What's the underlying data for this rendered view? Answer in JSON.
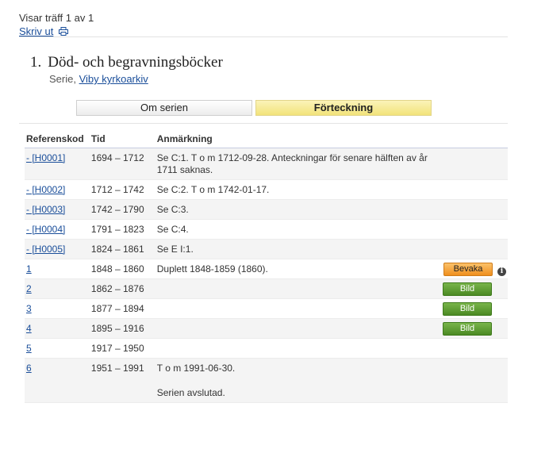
{
  "header": {
    "hits_text": "Visar träff 1 av 1",
    "print_label": "Skriv ut",
    "print_icon": "printer-icon"
  },
  "result": {
    "number": "1.",
    "title": "Död- och begravningsböcker",
    "type_label": "Serie,",
    "archive_link": "Viby kyrkoarkiv"
  },
  "tabs": [
    {
      "label": "Om serien",
      "active": false
    },
    {
      "label": "Förteckning",
      "active": true
    }
  ],
  "table": {
    "columns": [
      "Referenskod",
      "Tid",
      "Anmärkning"
    ],
    "rows": [
      {
        "ref": "- [H0001]",
        "time": "1694 – 1712",
        "note": "Se C:1. T o m 1712-09-28. Anteckningar för senare hälften av år 1711 saknas."
      },
      {
        "ref": "- [H0002]",
        "time": "1712 – 1742",
        "note": "Se C:2. T o m 1742-01-17."
      },
      {
        "ref": "- [H0003]",
        "time": "1742 – 1790",
        "note": "Se C:3."
      },
      {
        "ref": "- [H0004]",
        "time": "1791 – 1823",
        "note": "Se C:4."
      },
      {
        "ref": "- [H0005]",
        "time": "1824 – 1861",
        "note": "Se E I:1."
      },
      {
        "ref": "1",
        "time": "1848 – 1860",
        "note": "Duplett 1848-1859 (1860).",
        "button": "Bevaka",
        "info": true
      },
      {
        "ref": "2",
        "time": "1862 – 1876",
        "note": "",
        "button": "Bild"
      },
      {
        "ref": "3",
        "time": "1877 – 1894",
        "note": "",
        "button": "Bild"
      },
      {
        "ref": "4",
        "time": "1895 – 1916",
        "note": "",
        "button": "Bild"
      },
      {
        "ref": "5",
        "time": "1917 – 1950",
        "note": ""
      },
      {
        "ref": "6",
        "time": "1951 – 1991",
        "note": "T o m 1991-06-30.",
        "note2": "Serien avslutad."
      }
    ]
  },
  "colors": {
    "link": "#1a4e9a",
    "bild_button": "#5a9a2f",
    "bevaka_button": "#f2a23a",
    "active_tab": "#f4e88e"
  }
}
